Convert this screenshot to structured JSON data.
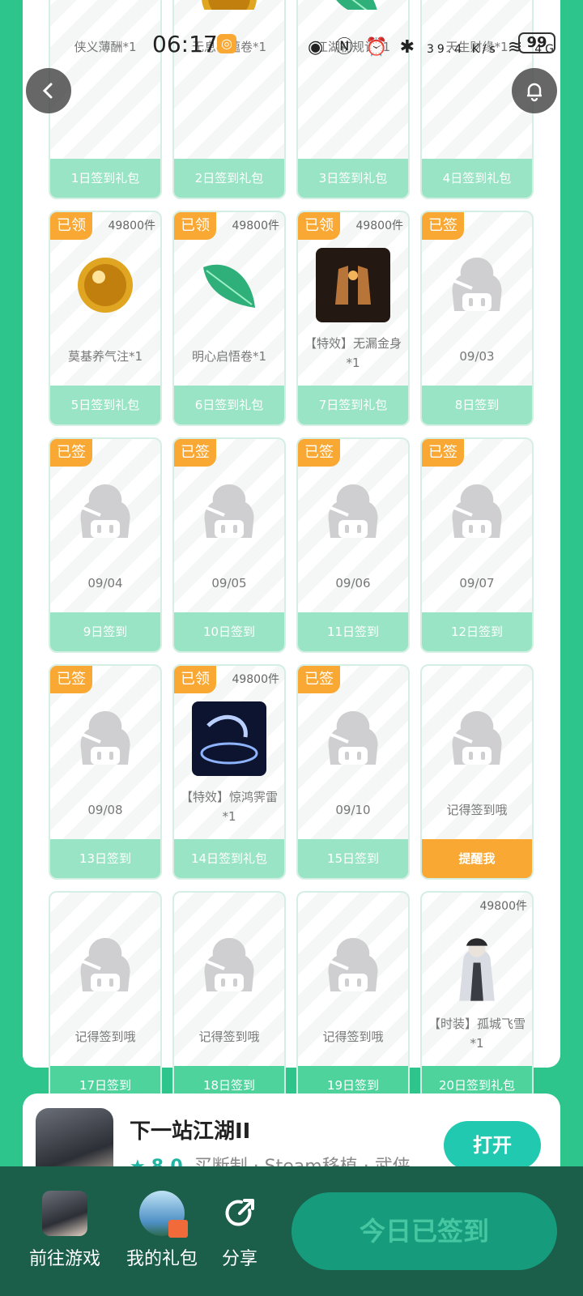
{
  "status_bar": {
    "time": "06:17",
    "net_speed": "39.4 K/s",
    "signal": "4G",
    "battery": "99"
  },
  "cards": [
    {
      "name": "侠义薄酬*1",
      "footer": "1日签到礼包",
      "badge": "",
      "stock": "",
      "icon": "coin-item-icon"
    },
    {
      "name": "无息初蕴卷*1",
      "footer": "2日签到礼包",
      "badge": "",
      "stock": "",
      "icon": "golden-orb-icon"
    },
    {
      "name": "江湖初规记*1",
      "footer": "3日签到礼包",
      "badge": "",
      "stock": "",
      "icon": "green-leaf-icon"
    },
    {
      "name": "天生财缘*1",
      "footer": "4日签到礼包",
      "badge": "",
      "stock": "",
      "icon": "scroll-item-icon"
    },
    {
      "name": "莫基养气注*1",
      "footer": "5日签到礼包",
      "badge": "已领",
      "stock": "49800件",
      "icon": "golden-orb-icon"
    },
    {
      "name": "明心启悟卷*1",
      "footer": "6日签到礼包",
      "badge": "已领",
      "stock": "49800件",
      "icon": "green-leaf-icon"
    },
    {
      "name": "【特效】无漏金身*1",
      "footer": "7日签到礼包",
      "badge": "已领",
      "stock": "49800件",
      "icon": "golden-body-effect-icon"
    },
    {
      "name": "09/03",
      "footer": "8日签到",
      "badge": "已签",
      "stock": "",
      "icon": "placeholder-mascot-icon"
    },
    {
      "name": "09/04",
      "footer": "9日签到",
      "badge": "已签",
      "stock": "",
      "icon": "placeholder-mascot-icon"
    },
    {
      "name": "09/05",
      "footer": "10日签到",
      "badge": "已签",
      "stock": "",
      "icon": "placeholder-mascot-icon"
    },
    {
      "name": "09/06",
      "footer": "11日签到",
      "badge": "已签",
      "stock": "",
      "icon": "placeholder-mascot-icon"
    },
    {
      "name": "09/07",
      "footer": "12日签到",
      "badge": "已签",
      "stock": "",
      "icon": "placeholder-mascot-icon"
    },
    {
      "name": "09/08",
      "footer": "13日签到",
      "badge": "已签",
      "stock": "",
      "icon": "placeholder-mascot-icon"
    },
    {
      "name": "【特效】惊鸿霁雷*1",
      "footer": "14日签到礼包",
      "badge": "已领",
      "stock": "49800件",
      "icon": "thunder-effect-icon"
    },
    {
      "name": "09/10",
      "footer": "15日签到",
      "badge": "已签",
      "stock": "",
      "icon": "placeholder-mascot-icon"
    },
    {
      "name": "记得签到哦",
      "footer": "提醒我",
      "badge": "",
      "stock": "",
      "icon": "placeholder-mascot-icon"
    },
    {
      "name": "记得签到哦",
      "footer": "17日签到",
      "badge": "",
      "stock": "",
      "icon": "placeholder-mascot-icon"
    },
    {
      "name": "记得签到哦",
      "footer": "18日签到",
      "badge": "",
      "stock": "",
      "icon": "placeholder-mascot-icon"
    },
    {
      "name": "记得签到哦",
      "footer": "19日签到",
      "badge": "",
      "stock": "",
      "icon": "placeholder-mascot-icon"
    },
    {
      "name": "【时装】孤城飞雪*1",
      "footer": "20日签到礼包",
      "badge": "",
      "stock": "49800件",
      "icon": "costume-figure-icon"
    }
  ],
  "game": {
    "title": "下一站江湖II",
    "score": "8.0",
    "tags": "买断制 · Steam移植 · 武侠",
    "open_label": "打开"
  },
  "bottom_nav": {
    "go_game": "前往游戏",
    "my_gifts": "我的礼包",
    "share": "分享",
    "checkin": "今日已签到"
  },
  "colors": {
    "accent_green": "#2ec58c",
    "badge_orange": "#f8a833",
    "footer_green": "#4fd39d",
    "bottom_bar": "#1b5e49"
  }
}
